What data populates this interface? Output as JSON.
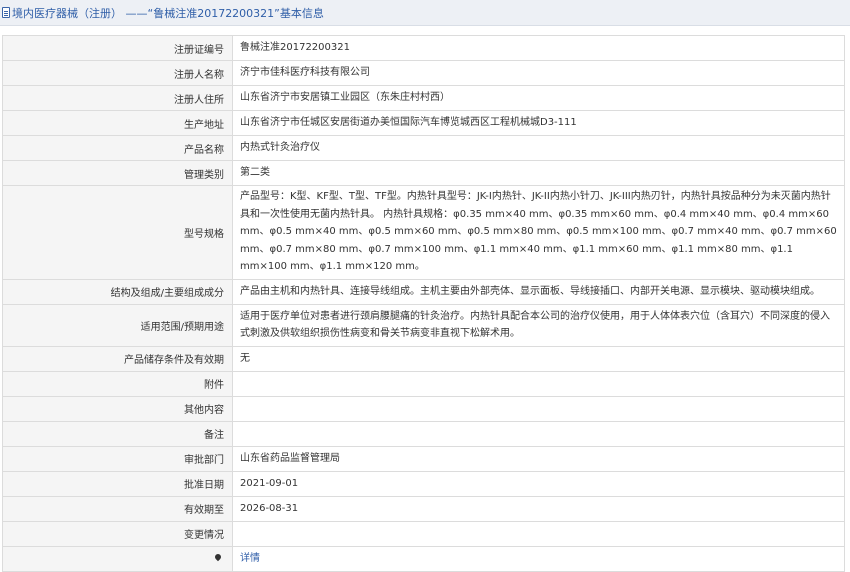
{
  "header": {
    "title": "境内医疗器械（注册） ——“鲁械注准20172200321”基本信息"
  },
  "rows": [
    {
      "label": "注册证编号",
      "value": "鲁械注准20172200321"
    },
    {
      "label": "注册人名称",
      "value": "济宁市佳科医疗科技有限公司"
    },
    {
      "label": "注册人住所",
      "value": "山东省济宁市安居镇工业园区（东朱庄村村西）"
    },
    {
      "label": "生产地址",
      "value": "山东省济宁市任城区安居街道办美恒国际汽车博览城西区工程机械城D3-111"
    },
    {
      "label": "产品名称",
      "value": "内热式针灸治疗仪"
    },
    {
      "label": "管理类别",
      "value": "第二类"
    },
    {
      "label": "型号规格",
      "value": "产品型号：K型、KF型、T型、TF型。内热针具型号：JK-I内热针、JK-II内热小针刀、JK-III内热刃针，内热针具按品种分为未灭菌内热针具和一次性使用无菌内热针具。 内热针具规格：φ0.35 mm×40 mm、φ0.35 mm×60 mm、φ0.4 mm×40 mm、φ0.4 mm×60 mm、φ0.5 mm×40 mm、φ0.5 mm×60 mm、φ0.5 mm×80 mm、φ0.5 mm×100 mm、φ0.7 mm×40 mm、φ0.7 mm×60 mm、φ0.7 mm×80 mm、φ0.7 mm×100 mm、φ1.1 mm×40 mm、φ1.1 mm×60 mm、φ1.1 mm×80 mm、φ1.1 mm×100 mm、φ1.1 mm×120 mm。"
    },
    {
      "label": "结构及组成/主要组成成分",
      "value": "产品由主机和内热针具、连接导线组成。主机主要由外部壳体、显示面板、导线接插口、内部开关电源、显示模块、驱动模块组成。"
    },
    {
      "label": "适用范围/预期用途",
      "value": "适用于医疗单位对患者进行颈肩腰腿痛的针灸治疗。内热针具配合本公司的治疗仪使用，用于人体体表穴位（含耳穴）不同深度的侵入式刺激及供软组织损伤性病变和骨关节病变非直视下松解术用。"
    },
    {
      "label": "产品储存条件及有效期",
      "value": "无"
    },
    {
      "label": "附件",
      "value": ""
    },
    {
      "label": "其他内容",
      "value": ""
    },
    {
      "label": "备注",
      "value": ""
    },
    {
      "label": "审批部门",
      "value": "山东省药品监督管理局"
    },
    {
      "label": "批准日期",
      "value": "2021-09-01"
    },
    {
      "label": "有效期至",
      "value": "2026-08-31"
    },
    {
      "label": "变更情况",
      "value": ""
    }
  ],
  "footer_row": {
    "icon": "location-pin-icon",
    "link_label": "详情"
  }
}
